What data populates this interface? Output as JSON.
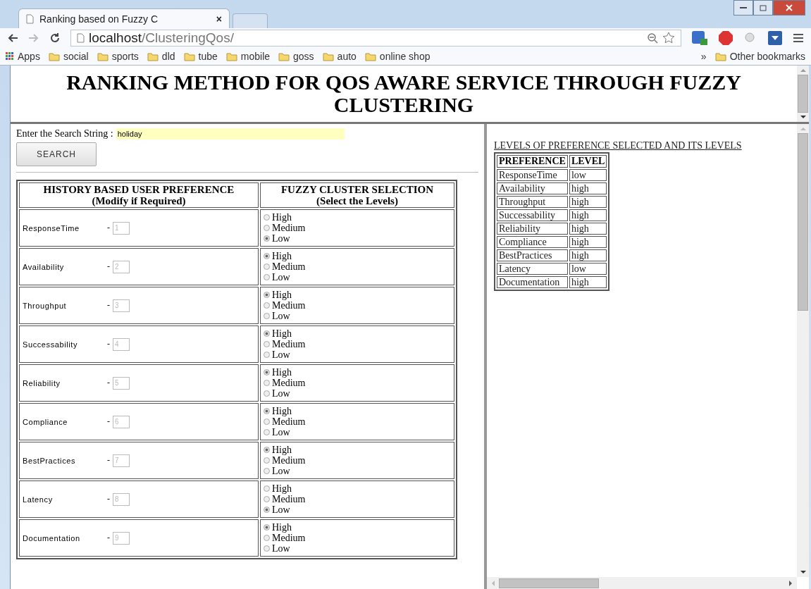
{
  "browser": {
    "tab_title": "Ranking based on Fuzzy C",
    "tab_close": "×",
    "address_host": "localhost",
    "address_path": "/ClusteringQos/",
    "apps_label": "Apps",
    "bookmarks": [
      "social",
      "sports",
      "dld",
      "tube",
      "mobile",
      "goss",
      "auto",
      "online shop"
    ],
    "overflow": "»",
    "other_bookmarks": "Other bookmarks"
  },
  "heading": "RANKING METHOD FOR QOS AWARE SERVICE THROUGH FUZZY CLUSTERING",
  "search": {
    "label": "Enter the Search String :",
    "value": "holiday",
    "button": "SEARCH"
  },
  "preference_table": {
    "columns": [
      {
        "title": "HISTORY BASED USER PREFERENCE",
        "subtitle": "(Modify if Required)"
      },
      {
        "title": "FUZZY CLUSTER SELECTION",
        "subtitle": "(Select the Levels)"
      }
    ],
    "rows": [
      {
        "name": "ResponseTime",
        "separator": "-",
        "rank": "1",
        "rank_disabled": true,
        "options": [
          {
            "label": "High",
            "selected": false
          },
          {
            "label": "Medium",
            "selected": false
          },
          {
            "label": "Low",
            "selected": true
          }
        ]
      },
      {
        "name": "Availability",
        "separator": "-",
        "rank": "2",
        "rank_disabled": true,
        "options": [
          {
            "label": "High",
            "selected": true
          },
          {
            "label": "Medium",
            "selected": false
          },
          {
            "label": "Low",
            "selected": false
          }
        ]
      },
      {
        "name": "Throughput",
        "separator": "-",
        "rank": "3",
        "rank_disabled": true,
        "options": [
          {
            "label": "High",
            "selected": true
          },
          {
            "label": "Medium",
            "selected": false
          },
          {
            "label": "Low",
            "selected": false
          }
        ]
      },
      {
        "name": "Successability",
        "separator": "-",
        "rank": "4",
        "rank_disabled": true,
        "options": [
          {
            "label": "High",
            "selected": true
          },
          {
            "label": "Medium",
            "selected": false
          },
          {
            "label": "Low",
            "selected": false
          }
        ]
      },
      {
        "name": "Reliability",
        "separator": "-",
        "rank": "5",
        "rank_disabled": true,
        "options": [
          {
            "label": "High",
            "selected": true
          },
          {
            "label": "Medium",
            "selected": false
          },
          {
            "label": "Low",
            "selected": false
          }
        ]
      },
      {
        "name": "Compliance",
        "separator": "-",
        "rank": "6",
        "rank_disabled": true,
        "options": [
          {
            "label": "High",
            "selected": true
          },
          {
            "label": "Medium",
            "selected": false
          },
          {
            "label": "Low",
            "selected": false
          }
        ]
      },
      {
        "name": "BestPractices",
        "separator": "-",
        "rank": "7",
        "rank_disabled": true,
        "options": [
          {
            "label": "High",
            "selected": true
          },
          {
            "label": "Medium",
            "selected": false
          },
          {
            "label": "Low",
            "selected": false
          }
        ]
      },
      {
        "name": "Latency",
        "separator": "-",
        "rank": "8",
        "rank_disabled": true,
        "options": [
          {
            "label": "High",
            "selected": false
          },
          {
            "label": "Medium",
            "selected": false
          },
          {
            "label": "Low",
            "selected": true
          }
        ]
      },
      {
        "name": "Documentation",
        "separator": "-",
        "rank": "9",
        "rank_disabled": true,
        "options": [
          {
            "label": "High",
            "selected": true
          },
          {
            "label": "Medium",
            "selected": false
          },
          {
            "label": "Low",
            "selected": false
          }
        ]
      }
    ]
  },
  "result": {
    "title": "LEVELS OF PREFERENCE SELECTED AND ITS LEVELS",
    "columns": [
      "PREFERENCE",
      "LEVEL"
    ],
    "rows": [
      [
        "ResponseTime",
        "low"
      ],
      [
        "Availability",
        "high"
      ],
      [
        "Throughput",
        "high"
      ],
      [
        "Successability",
        "high"
      ],
      [
        "Reliability",
        "high"
      ],
      [
        "Compliance",
        "high"
      ],
      [
        "BestPractices",
        "high"
      ],
      [
        "Latency",
        "low"
      ],
      [
        "Documentation",
        "high"
      ]
    ]
  }
}
